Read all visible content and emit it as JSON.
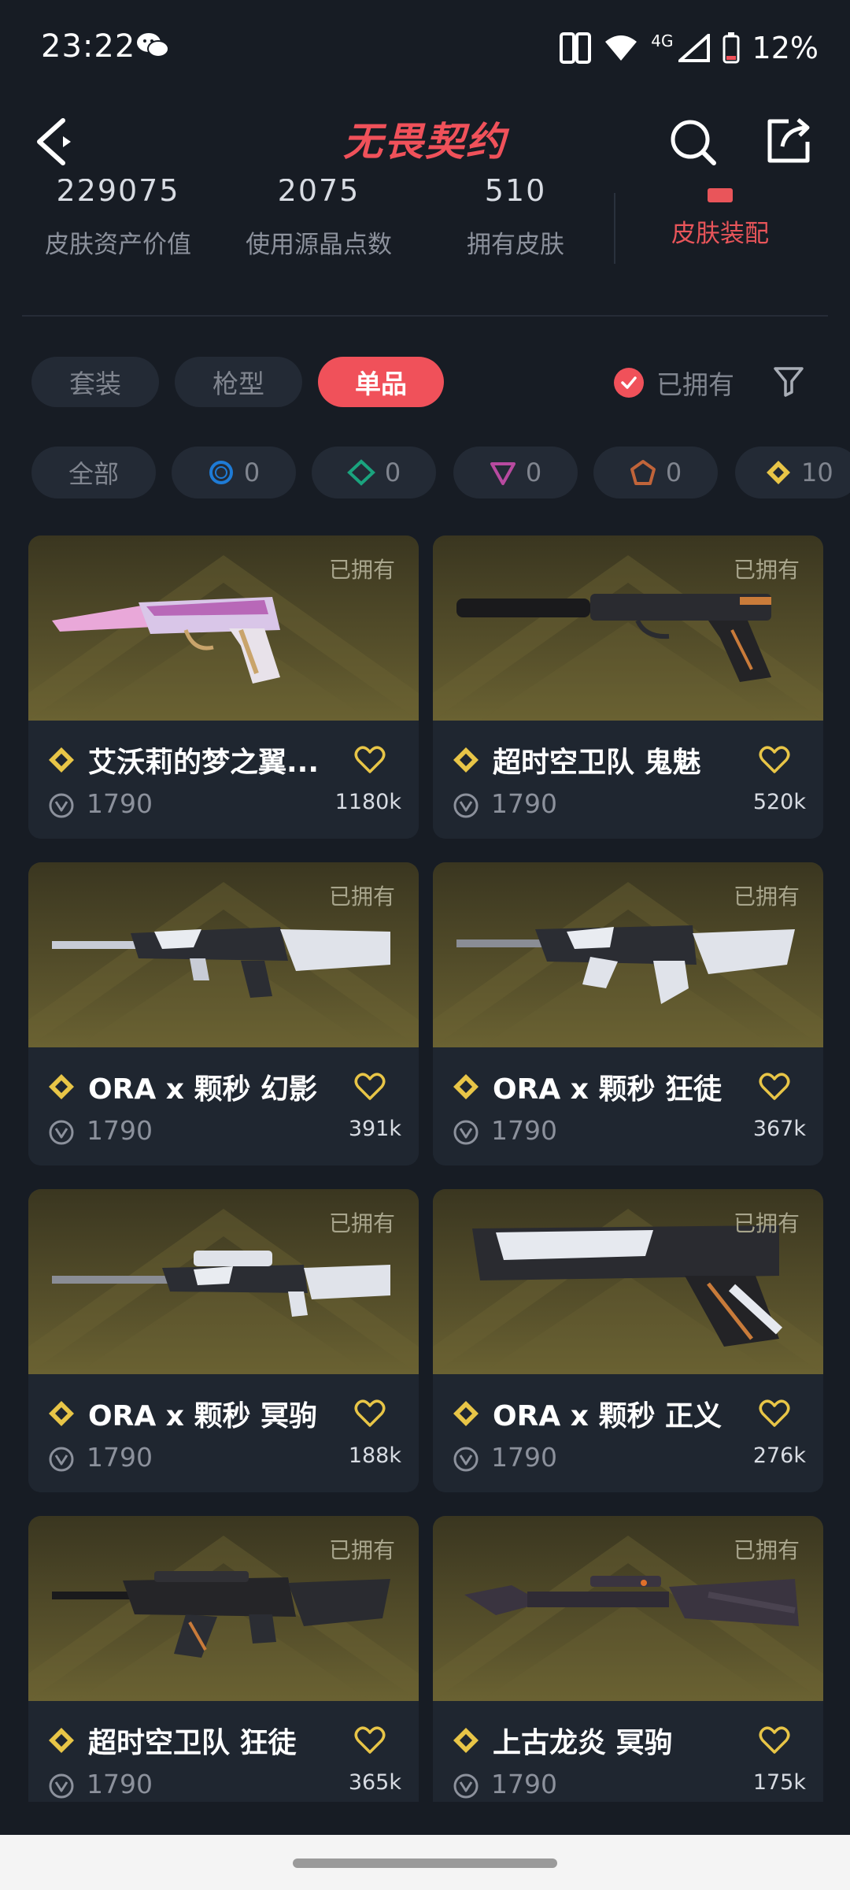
{
  "status_bar": {
    "time": "23:22",
    "network": "4G",
    "battery": "12%"
  },
  "header": {
    "title": "无畏契约"
  },
  "stats": [
    {
      "value": "229075",
      "label": "皮肤资产价值"
    },
    {
      "value": "2075",
      "label": "使用源晶点数"
    },
    {
      "value": "510",
      "label": "拥有皮肤"
    },
    {
      "value": "",
      "label": "皮肤装配"
    }
  ],
  "tabs": [
    {
      "label": "套装",
      "active": false
    },
    {
      "label": "枪型",
      "active": false
    },
    {
      "label": "单品",
      "active": true
    }
  ],
  "owned_filter": {
    "label": "已拥有",
    "checked": true
  },
  "tier_filters": {
    "all_label": "全部",
    "items": [
      {
        "icon": "select-tier-icon",
        "color": "#1e7bd6",
        "count": "0"
      },
      {
        "icon": "deluxe-tier-icon",
        "color": "#1aa37e",
        "count": "0"
      },
      {
        "icon": "premium-tier-icon",
        "color": "#b84aa0",
        "count": "0"
      },
      {
        "icon": "ultra-tier-icon",
        "color": "#c0643a",
        "count": "0"
      },
      {
        "icon": "exclusive-tier-icon",
        "color": "#e8c547",
        "count": "10"
      }
    ]
  },
  "items": [
    {
      "name": "艾沃莉的梦之翼...",
      "price": "1790",
      "likes": "1180k",
      "owned": "已拥有",
      "gun": "pistol-pink"
    },
    {
      "name": "超时空卫队 鬼魅",
      "price": "1790",
      "likes": "520k",
      "owned": "已拥有",
      "gun": "pistol-silencer"
    },
    {
      "name": "ORA x 颗秒 幻影",
      "price": "1790",
      "likes": "391k",
      "owned": "已拥有",
      "gun": "rifle-phantom"
    },
    {
      "name": "ORA x 颗秒 狂徒",
      "price": "1790",
      "likes": "367k",
      "owned": "已拥有",
      "gun": "rifle-vandal"
    },
    {
      "name": "ORA x 颗秒 冥驹",
      "price": "1790",
      "likes": "188k",
      "owned": "已拥有",
      "gun": "sniper"
    },
    {
      "name": "ORA x 颗秒 正义",
      "price": "1790",
      "likes": "276k",
      "owned": "已拥有",
      "gun": "pistol-sheriff"
    },
    {
      "name": "超时空卫队 狂徒",
      "price": "1790",
      "likes": "365k",
      "owned": "已拥有",
      "gun": "rifle-dark"
    },
    {
      "name": "上古龙炎 冥驹",
      "price": "1790",
      "likes": "175k",
      "owned": "已拥有",
      "gun": "sniper-dragon"
    }
  ],
  "colors": {
    "accent": "#f0515a",
    "gold": "#e8c547",
    "background": "#171c24"
  }
}
